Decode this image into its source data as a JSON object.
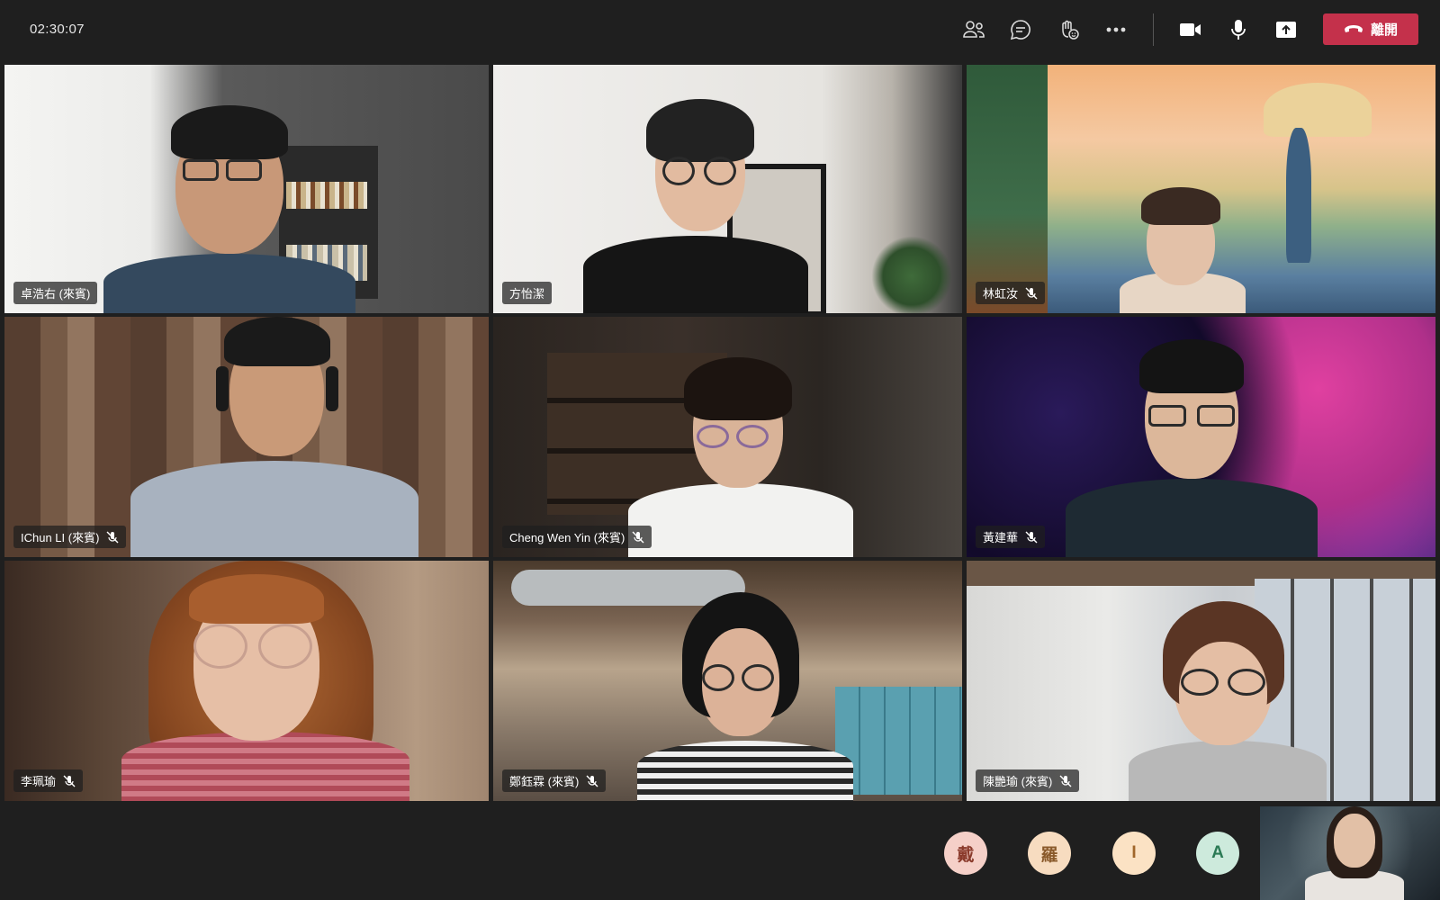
{
  "meeting": {
    "timer": "02:30:07",
    "leave_label": "離開"
  },
  "toolbar": {
    "icons": [
      "people-icon",
      "chat-icon",
      "reactions-icon",
      "more-icon",
      "camera-icon",
      "microphone-icon",
      "share-screen-icon",
      "phone-hangup-icon"
    ]
  },
  "participants": [
    {
      "name": "卓浩右 (來賓)",
      "muted": false
    },
    {
      "name": "方怡潔",
      "muted": false
    },
    {
      "name": "林虹汝",
      "muted": true
    },
    {
      "name": "IChun LI (來賓)",
      "muted": true
    },
    {
      "name": "Cheng Wen Yin (來賓)",
      "muted": true
    },
    {
      "name": "黃建華",
      "muted": true
    },
    {
      "name": "李珮瑜",
      "muted": true
    },
    {
      "name": "鄭鈺霖 (來賓)",
      "muted": true
    },
    {
      "name": "陳艷瑜 (來賓)",
      "muted": true
    }
  ],
  "audience_avatars": [
    {
      "initial": "戴",
      "bg": "#f5d0c8",
      "fg": "#8a3a2b"
    },
    {
      "initial": "羅",
      "bg": "#f7dcc0",
      "fg": "#8a5a2b"
    },
    {
      "initial": "I",
      "bg": "#fbe2c4",
      "fg": "#a0662b"
    },
    {
      "initial": "A",
      "bg": "#cdeadc",
      "fg": "#2b7a55"
    }
  ],
  "colors": {
    "leave_button": "#c4314b",
    "background": "#1f1f1f"
  }
}
